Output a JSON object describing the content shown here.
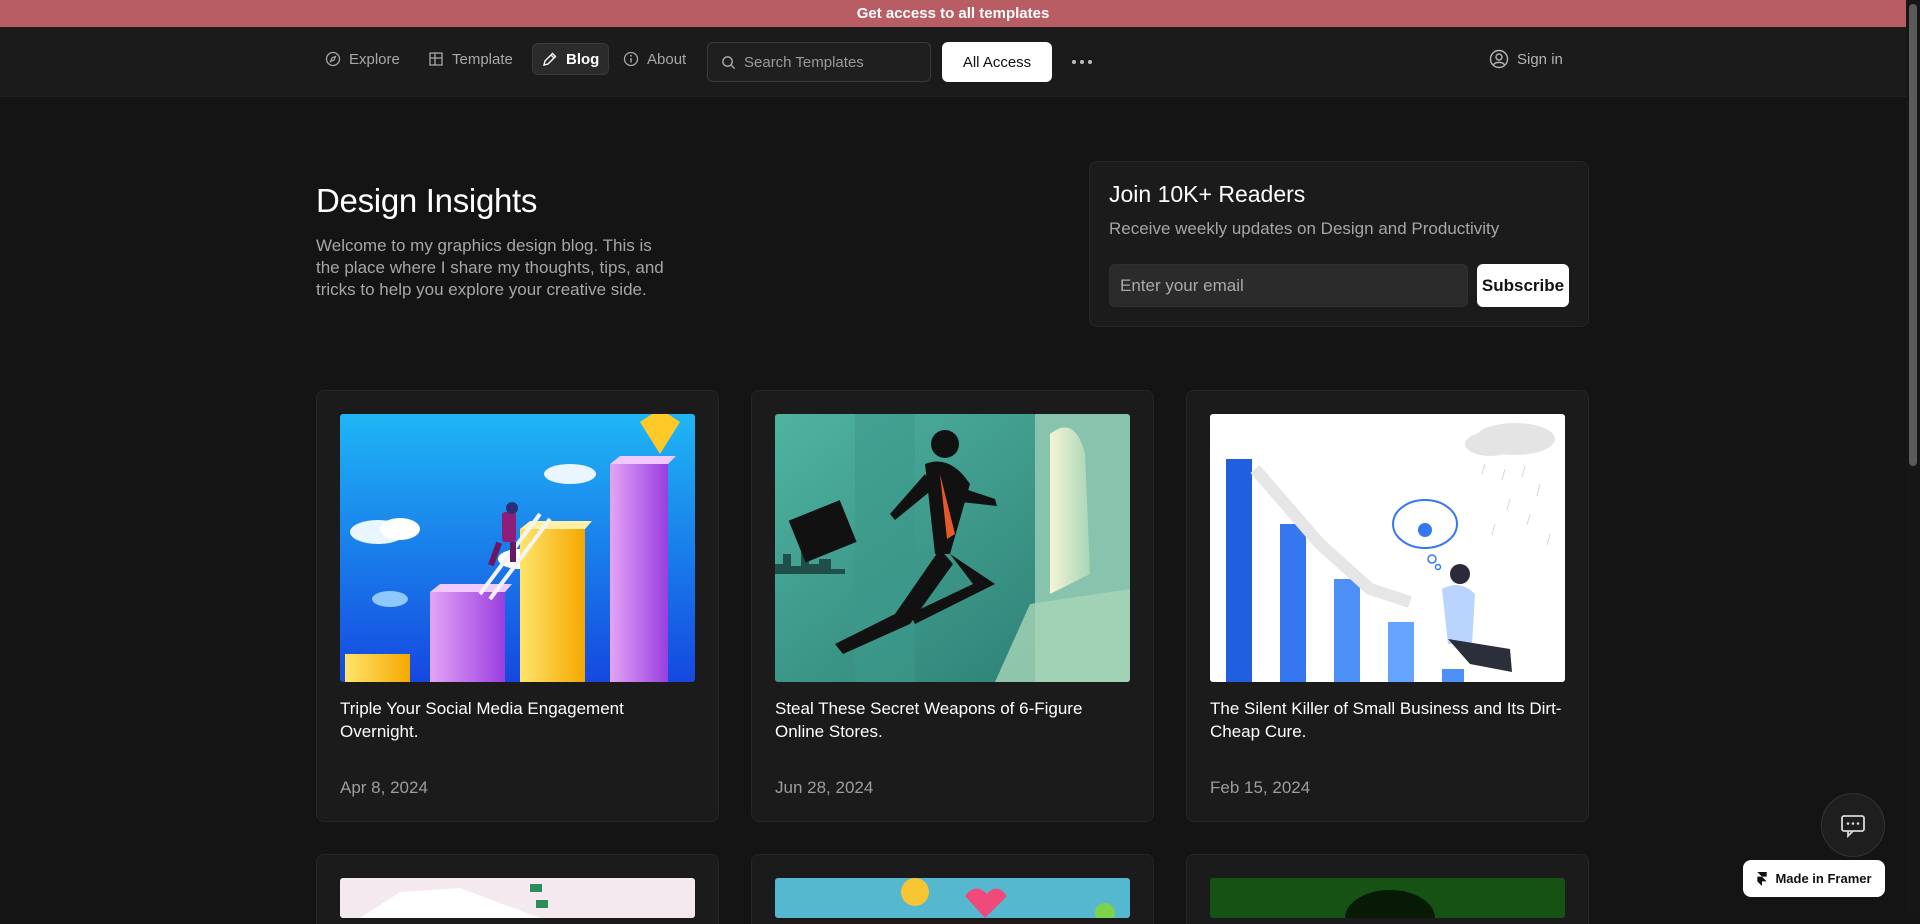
{
  "banner": {
    "text": "Get access to all templates"
  },
  "nav": {
    "items": [
      {
        "label": "Explore",
        "icon": "compass-icon"
      },
      {
        "label": "Template",
        "icon": "grid-icon"
      },
      {
        "label": "Blog",
        "icon": "pen-icon",
        "active": true
      },
      {
        "label": "About",
        "icon": "info-icon"
      }
    ],
    "search_placeholder": "Search Templates",
    "all_access_label": "All Access",
    "sign_in_label": "Sign in"
  },
  "hero": {
    "title": "Design Insights",
    "text": "Welcome to my graphics design blog. This is the place where I share my thoughts, tips, and tricks to help you explore your creative side."
  },
  "newsletter": {
    "title": "Join 10K+ Readers",
    "subtitle": "Receive weekly updates on Design and Productivity",
    "email_placeholder": "Enter your email",
    "subscribe_label": "Subscribe"
  },
  "posts": [
    {
      "title": "Triple Your Social Media Engagement Overnight.",
      "date": "Apr 8, 2024",
      "image": "growth-bars-illustration"
    },
    {
      "title": "Steal These Secret Weapons of 6-Figure Online Stores.",
      "date": "Jun 28, 2024",
      "image": "businessman-running-illustration"
    },
    {
      "title": "The Silent Killer of Small Business and Its Dirt-Cheap Cure.",
      "date": "Feb 15, 2024",
      "image": "declining-chart-illustration"
    }
  ],
  "footer": {
    "made_in_framer": "Made in Framer"
  },
  "colors": {
    "banner": "#b95d65",
    "background": "#141414",
    "card": "#1b1b1b"
  }
}
